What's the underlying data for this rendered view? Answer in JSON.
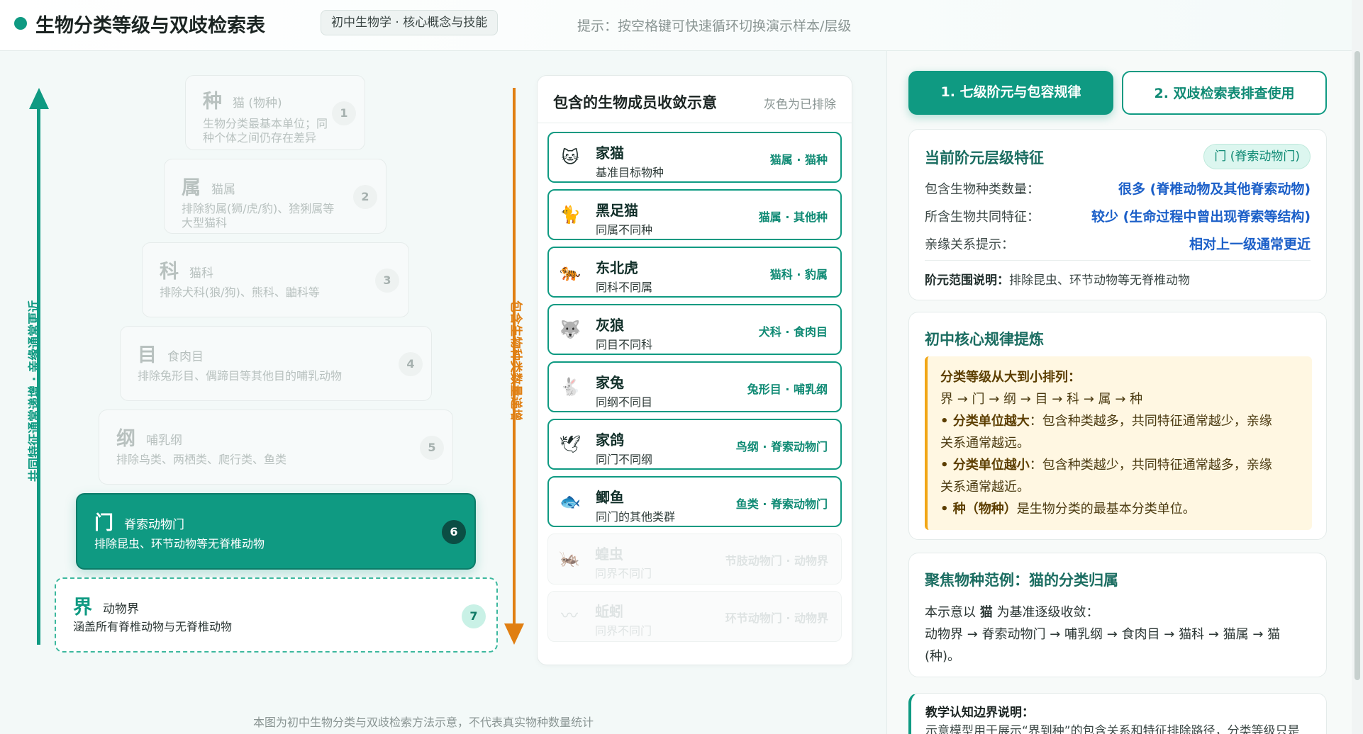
{
  "header": {
    "title": "生物分类等级与双歧检索表",
    "badge": "初中生物学 · 核心概念与技能",
    "hint": "提示：按空格键可快速循环切换演示样本/层级"
  },
  "arrows": {
    "left_label": "共同特征通常递增 · 亲缘通常更近",
    "right_label": "包含生物种类数量递增"
  },
  "pyramid": [
    {
      "name": "种",
      "example": "猫 (物种)",
      "desc": "生物分类最基本单位；同种个体之间仍存在差异",
      "num": "1",
      "state": "faded"
    },
    {
      "name": "属",
      "example": "猫属",
      "desc": "排除豹属(狮/虎/豹)、猞猁属等大型猫科",
      "num": "2",
      "state": "faded"
    },
    {
      "name": "科",
      "example": "猫科",
      "desc": "排除犬科(狼/狗)、熊科、鼬科等",
      "num": "3",
      "state": "faded"
    },
    {
      "name": "目",
      "example": "食肉目",
      "desc": "排除兔形目、偶蹄目等其他目的哺乳动物",
      "num": "4",
      "state": "faded"
    },
    {
      "name": "纲",
      "example": "哺乳纲",
      "desc": "排除鸟类、两栖类、爬行类、鱼类",
      "num": "5",
      "state": "faded"
    },
    {
      "name": "门",
      "example": "脊索动物门",
      "desc": "排除昆虫、环节动物等无脊椎动物",
      "num": "6",
      "state": "active"
    },
    {
      "name": "界",
      "example": "动物界",
      "desc": "涵盖所有脊椎动物与无脊椎动物",
      "num": "7",
      "state": "base"
    }
  ],
  "members": {
    "title": "包含的生物成员收敛示意",
    "note": "灰色为已排除",
    "items": [
      {
        "icon": "🐱",
        "icon_name": "cat-icon",
        "name": "家猫",
        "relation": "基准目标物种",
        "tag": "猫属 · 猫种",
        "excluded": false
      },
      {
        "icon": "🐈",
        "icon_name": "wildcat-icon",
        "name": "黑足猫",
        "relation": "同属不同种",
        "tag": "猫属 · 其他种",
        "excluded": false
      },
      {
        "icon": "🐅",
        "icon_name": "tiger-icon",
        "name": "东北虎",
        "relation": "同科不同属",
        "tag": "猫科 · 豹属",
        "excluded": false
      },
      {
        "icon": "🐺",
        "icon_name": "wolf-icon",
        "name": "灰狼",
        "relation": "同目不同科",
        "tag": "犬科 · 食肉目",
        "excluded": false
      },
      {
        "icon": "🐇",
        "icon_name": "rabbit-icon",
        "name": "家兔",
        "relation": "同纲不同目",
        "tag": "兔形目 · 哺乳纲",
        "excluded": false
      },
      {
        "icon": "🕊",
        "icon_name": "dove-icon",
        "name": "家鸽",
        "relation": "同门不同纲",
        "tag": "鸟纲 · 脊索动物门",
        "excluded": false
      },
      {
        "icon": "🐟",
        "icon_name": "fish-icon",
        "name": "鲫鱼",
        "relation": "同门的其他类群",
        "tag": "鱼类 · 脊索动物门",
        "excluded": false
      },
      {
        "icon": "🦗",
        "icon_name": "locust-icon",
        "name": "蝗虫",
        "relation": "同界不同门",
        "tag": "节肢动物门 · 动物界",
        "excluded": true
      },
      {
        "icon": "〰",
        "icon_name": "earthworm-icon",
        "name": "蚯蚓",
        "relation": "同界不同门",
        "tag": "环节动物门 · 动物界",
        "excluded": true
      }
    ]
  },
  "footnote": "本图为初中生物分类与双歧检索方法示意，不代表真实物种数量统计",
  "tabs": [
    {
      "label": "1. 七级阶元与包容规律",
      "active": true
    },
    {
      "label": "2. 双歧检索表排查使用",
      "active": false
    }
  ],
  "current_level": {
    "title": "当前阶元层级特征",
    "pill": "门 (脊索动物门)",
    "rows": [
      {
        "label": "包含生物种类数量：",
        "value": "很多 (脊椎动物及其他脊索动物)"
      },
      {
        "label": "所含生物共同特征：",
        "value": "较少 (生命过程中曾出现脊索等结构)"
      },
      {
        "label": "亲缘关系提示：",
        "value": "相对上一级通常更近"
      }
    ],
    "scope_label": "阶元范围说明：",
    "scope_text": "排除昆虫、环节动物等无脊椎动物"
  },
  "rules": {
    "title": "初中核心规律提炼",
    "box_title": "分类等级从大到小排列：",
    "order": "界 → 门 → 纲 → 目 → 科 → 属 → 种",
    "rule1_bold": "• 分类单位越大",
    "rule1_a": "：包含种类越多，共同特征通常越少，亲缘",
    "rule1_b": "关系通常越远。",
    "rule2_bold": "• 分类单位越小",
    "rule2_a": "：包含种类越少，共同特征通常越多，亲缘",
    "rule2_b": "关系通常越近。",
    "rule3_bold": "• 种（物种）",
    "rule3_a": "是生物分类的最基本分类单位。"
  },
  "focus": {
    "title": "聚焦物种范例：猫的分类归属",
    "line1_pre": "本示意以 ",
    "line1_bold": "猫",
    "line1_post": " 为基准逐级收敛：",
    "line2": "动物界 → 脊索动物门 → 哺乳纲 → 食肉目 → 猫科 → 猫属 → 猫",
    "line3": "(种)。"
  },
  "teaching": {
    "title": "教学认知边界说明：",
    "text": "示意模型用于展示“界到种”的包含关系和特征排除路径，分类等级只是"
  },
  "colors": {
    "accent": "#0f9a82",
    "orange": "#e07f12",
    "blue_value": "#1b5fc8",
    "rule_bg": "#fff7e2"
  }
}
